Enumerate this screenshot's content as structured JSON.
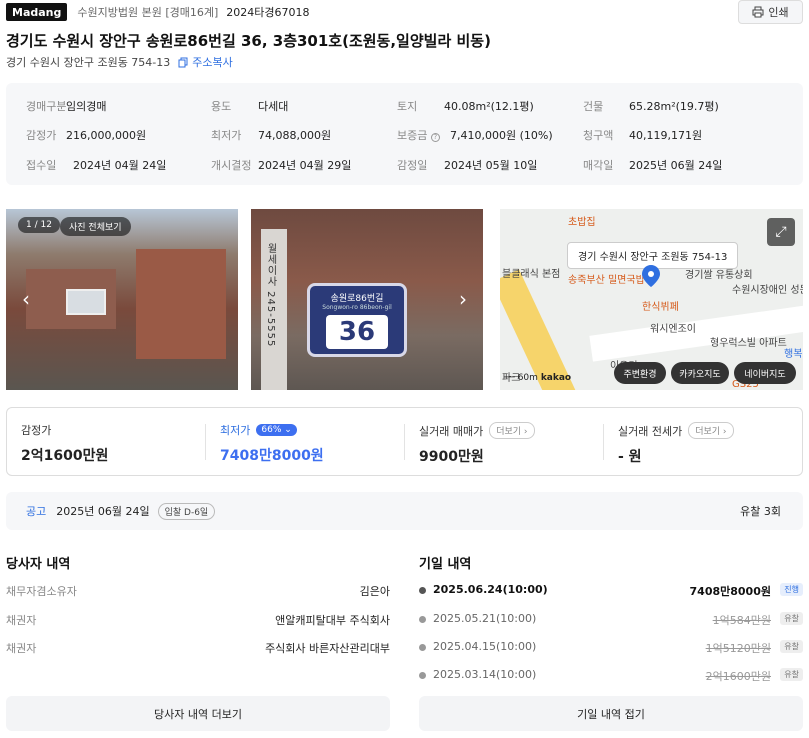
{
  "header": {
    "brand": "Madang",
    "court": "수원지방법원 본원 [경매16계]",
    "case_no": "2024타경67018",
    "print_label": "인쇄"
  },
  "title": "경기도 수원시 장안구 송원로86번길 36, 3층301호(조원동,일양빌라 비동)",
  "lot_address": "경기 수원시 장안구 조원동 754-13",
  "copy_address_label": "주소복사",
  "info": [
    {
      "label": "경매구분",
      "value": "임의경매"
    },
    {
      "label": "용도",
      "value": "다세대"
    },
    {
      "label": "토지",
      "value": "40.08m²(12.1평)"
    },
    {
      "label": "건물",
      "value": "65.28m²(19.7평)"
    },
    {
      "label": "감정가",
      "value": "216,000,000원"
    },
    {
      "label": "최저가",
      "value": "74,088,000원"
    },
    {
      "label": "보증금",
      "value": "7,410,000원 (10%)"
    },
    {
      "label": "청구액",
      "value": "40,119,171원"
    },
    {
      "label": "접수일",
      "value": "2024년 04월 24일"
    },
    {
      "label": "개시결정",
      "value": "2024년 04월 29일"
    },
    {
      "label": "감정일",
      "value": "2024년 05월 10일"
    },
    {
      "label": "매각일",
      "value": "2025년 06월 24일"
    }
  ],
  "photos": {
    "counter": "1 / 12",
    "all_photos_label": "사진 전체보기",
    "plate_street": "송원로86번길",
    "plate_roman": "Songwon-ro 86beon-gil",
    "plate_number": "36",
    "pole_text": "월세이사 245-5555"
  },
  "map": {
    "tooltip": "경기 수원시 장안구 조원동 754-13",
    "labels": [
      "초밥집",
      "블클래식 본점",
      "송죽부산 밀면국밥",
      "경기쌀 유통상회",
      "수원시장애인 성문화센터",
      "한식뷔페",
      "워시엔조이",
      "형우럭스빌 아파트",
      "행복",
      "이유기",
      "파크",
      "GS25"
    ],
    "scale": "60m",
    "kakao": "kakao",
    "buttons": [
      "주변환경",
      "카카오지도",
      "네이버지도"
    ]
  },
  "prices": {
    "appraisal_label": "감정가",
    "appraisal": "2억1600만원",
    "min_label": "최저가",
    "min_pct": "66%",
    "min": "7408만8000원",
    "sale_label": "실거래 매매가",
    "sale": "9900만원",
    "jeonse_label": "실거래 전세가",
    "jeonse": "- 원",
    "more": "더보기"
  },
  "notice": {
    "label": "공고",
    "date": "2025년 06월 24일",
    "dday": "입찰 D-6일",
    "fail_count": "유찰 3회"
  },
  "parties": {
    "title": "당사자 내역",
    "rows": [
      {
        "role": "채무자겸소유자",
        "name": "김은아"
      },
      {
        "role": "채권자",
        "name": "앤알캐피탈대부 주식회사"
      },
      {
        "role": "채권자",
        "name": "주식회사 바른자산관리대부"
      }
    ],
    "more_label": "당사자 내역 더보기"
  },
  "schedule": {
    "title": "기일 내역",
    "rows": [
      {
        "date": "2025.06.24(10:00)",
        "amount": "7408만8000원",
        "status": "진행"
      },
      {
        "date": "2025.05.21(10:00)",
        "amount": "1억584만원",
        "status": "유찰"
      },
      {
        "date": "2025.04.15(10:00)",
        "amount": "1억5120만원",
        "status": "유찰"
      },
      {
        "date": "2025.03.14(10:00)",
        "amount": "2억1600만원",
        "status": "유찰"
      }
    ],
    "collapse_label": "기일 내역 접기"
  },
  "colors": {
    "accent": "#2f6fe0",
    "badge": "#3d6ff0"
  }
}
